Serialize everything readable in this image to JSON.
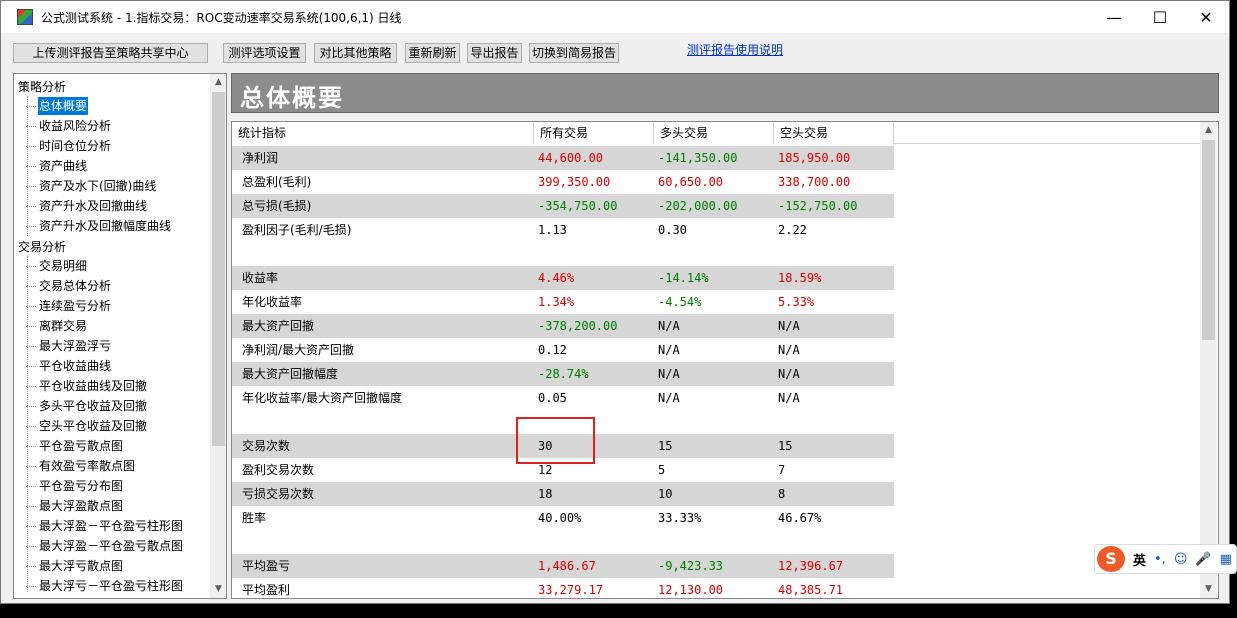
{
  "window": {
    "title": "公式测试系统 - 1.指标交易：ROC变动速率交易系统(100,6,1) 日线",
    "minimize": "—",
    "maximize": "☐",
    "close": "✕"
  },
  "toolbar": {
    "upload": "上传测评报告至策略共享中心",
    "options": "测评选项设置",
    "compare": "对比其他策略",
    "refresh": "重新刷新",
    "export": "导出报告",
    "switch": "切换到简易报告",
    "help": "测评报告使用说明"
  },
  "tree": {
    "group1": "策略分析",
    "items1": [
      "总体概要",
      "收益风险分析",
      "时间仓位分析",
      "资产曲线",
      "资产及水下(回撤)曲线",
      "资产升水及回撤曲线",
      "资产升水及回撤幅度曲线"
    ],
    "group2": "交易分析",
    "items2": [
      "交易明细",
      "交易总体分析",
      "连续盈亏分析",
      "离群交易",
      "最大浮盈浮亏",
      "平仓收益曲线",
      "平仓收益曲线及回撤",
      "多头平仓收益及回撤",
      "空头平仓收益及回撤",
      "平仓盈亏散点图",
      "有效盈亏率散点图",
      "平仓盈亏分布图",
      "最大浮盈散点图",
      "最大浮盈－平仓盈亏柱形图",
      "最大浮盈－平仓盈亏散点图",
      "最大浮亏散点图",
      "最大浮亏－平仓盈亏柱形图"
    ]
  },
  "main": {
    "banner_title": "总体概要",
    "headers": [
      "统计指标",
      "所有交易",
      "多头交易",
      "空头交易"
    ],
    "rows": [
      {
        "label": "净利润",
        "v": [
          "44,600.00",
          "-141,350.00",
          "185,950.00"
        ],
        "c": [
          "pos",
          "neg",
          "pos"
        ],
        "shade": true
      },
      {
        "label": "总盈利(毛利)",
        "v": [
          "399,350.00",
          "60,650.00",
          "338,700.00"
        ],
        "c": [
          "pos",
          "pos",
          "pos"
        ],
        "shade": false
      },
      {
        "label": "总亏损(毛损)",
        "v": [
          "-354,750.00",
          "-202,000.00",
          "-152,750.00"
        ],
        "c": [
          "neg",
          "neg",
          "neg"
        ],
        "shade": true
      },
      {
        "label": "盈利因子(毛利/毛损)",
        "v": [
          "1.13",
          "0.30",
          "2.22"
        ],
        "c": [
          "neu",
          "neu",
          "neu"
        ],
        "shade": false
      },
      {
        "label": "",
        "v": [
          "",
          "",
          ""
        ],
        "c": [
          "neu",
          "neu",
          "neu"
        ],
        "shade": false
      },
      {
        "label": "收益率",
        "v": [
          "4.46%",
          "-14.14%",
          "18.59%"
        ],
        "c": [
          "pos",
          "neg",
          "pos"
        ],
        "shade": true
      },
      {
        "label": "年化收益率",
        "v": [
          "1.34%",
          "-4.54%",
          "5.33%"
        ],
        "c": [
          "pos",
          "neg",
          "pos"
        ],
        "shade": false
      },
      {
        "label": "最大资产回撤",
        "v": [
          "-378,200.00",
          "N/A",
          "N/A"
        ],
        "c": [
          "neg",
          "neu",
          "neu"
        ],
        "shade": true
      },
      {
        "label": "净利润/最大资产回撤",
        "v": [
          "0.12",
          "N/A",
          "N/A"
        ],
        "c": [
          "neu",
          "neu",
          "neu"
        ],
        "shade": false
      },
      {
        "label": "最大资产回撤幅度",
        "v": [
          "-28.74%",
          "N/A",
          "N/A"
        ],
        "c": [
          "neg",
          "neu",
          "neu"
        ],
        "shade": true
      },
      {
        "label": "年化收益率/最大资产回撤幅度",
        "v": [
          "0.05",
          "N/A",
          "N/A"
        ],
        "c": [
          "neu",
          "neu",
          "neu"
        ],
        "shade": false
      },
      {
        "label": "",
        "v": [
          "",
          "",
          ""
        ],
        "c": [
          "neu",
          "neu",
          "neu"
        ],
        "shade": false
      },
      {
        "label": "交易次数",
        "v": [
          "30",
          "15",
          "15"
        ],
        "c": [
          "neu",
          "neu",
          "neu"
        ],
        "shade": true
      },
      {
        "label": "盈利交易次数",
        "v": [
          "12",
          "5",
          "7"
        ],
        "c": [
          "neu",
          "neu",
          "neu"
        ],
        "shade": false
      },
      {
        "label": "亏损交易次数",
        "v": [
          "18",
          "10",
          "8"
        ],
        "c": [
          "neu",
          "neu",
          "neu"
        ],
        "shade": true
      },
      {
        "label": "胜率",
        "v": [
          "40.00%",
          "33.33%",
          "46.67%"
        ],
        "c": [
          "neu",
          "neu",
          "neu"
        ],
        "shade": false
      },
      {
        "label": "",
        "v": [
          "",
          "",
          ""
        ],
        "c": [
          "neu",
          "neu",
          "neu"
        ],
        "shade": false
      },
      {
        "label": "平均盈亏",
        "v": [
          "1,486.67",
          "-9,423.33",
          "12,396.67"
        ],
        "c": [
          "pos",
          "neg",
          "pos"
        ],
        "shade": true
      },
      {
        "label": "平均盈利",
        "v": [
          "33,279.17",
          "12,130.00",
          "48,385.71"
        ],
        "c": [
          "pos",
          "pos",
          "pos"
        ],
        "shade": false
      }
    ]
  },
  "ime": {
    "logo": "S",
    "mode": "英",
    "punct": "•,",
    "emoji": "☺",
    "mic": "🎤",
    "more": "▦"
  },
  "colors": {
    "positive": "#e00000",
    "negative": "#008000",
    "selection": "#0078d7",
    "highlight": "#e02020"
  }
}
